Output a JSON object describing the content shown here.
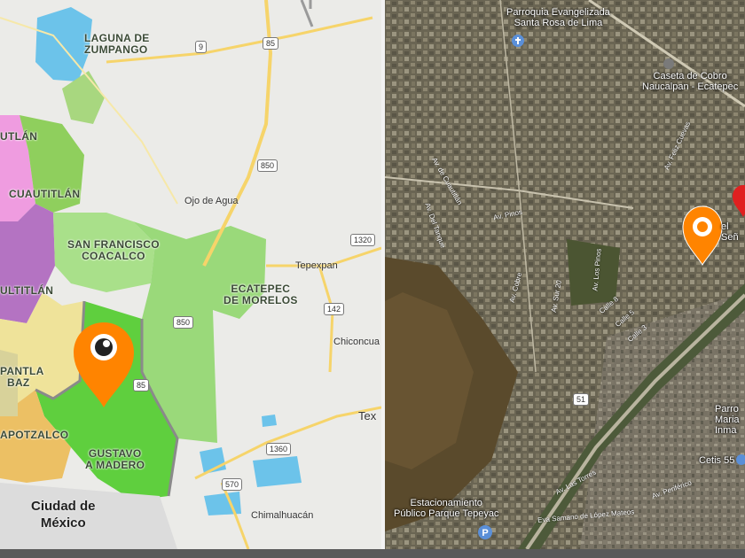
{
  "left_map": {
    "water": {
      "name": "LAGUNA DE ZUMPANGO",
      "line1": "LAGUNA DE",
      "line2": "ZUMPANGO"
    },
    "regions": {
      "cuautitlan_top": "UTLÁN",
      "cuautitlan": "CUAUTITLÁN",
      "san_francisco_line1": "SAN FRANCISCO",
      "san_francisco_line2": "COACALCO",
      "tultitlan": "ULTITLÁN",
      "ecatepec_line1": "ECATEPEC",
      "ecatepec_line2": "DE MORELOS",
      "tlalnepantla_line1": "PANTLA",
      "tlalnepantla_line2": "BAZ",
      "azcapotzalco": "APOTZALCO",
      "gustavo_line1": "GUSTAVO",
      "gustavo_line2": "A MADERO"
    },
    "places": {
      "ojo_de_agua": "Ojo de Agua",
      "tepexpan": "Tepexpan",
      "chiconcuac": "Chiconcua",
      "texcoco": "Tex",
      "chimalhuacan": "Chimalhuacán",
      "ciudad_line1": "Ciudad de",
      "ciudad_line2": "México"
    },
    "shields": {
      "r9": "9",
      "r85": "85",
      "r850": "850",
      "r1320": "1320",
      "r142": "142",
      "r1360": "1360",
      "r570": "570",
      "r850b": "850",
      "r85b": "85"
    },
    "marker_icon": "location-pin-icon",
    "colors": {
      "marker": "#ff8400",
      "water": "#6cc3ea"
    }
  },
  "right_map": {
    "labels": {
      "parroquia_line1": "Parroquia Evangelizada",
      "parroquia_line2": "Santa Rosa de Lima",
      "caseta_line1": "Caseta de Cobro",
      "caseta_line2": "Naucalpan - Ecatepec",
      "estacionamiento_line1": "Estacionamiento",
      "estacionamiento_line2": "Público Parque Tepeyac",
      "parroquia2_line1": "Parro",
      "parroquia2_line2": "Maria Inma",
      "cetis": "Cetis 55",
      "senor": "el Señ",
      "r51": "51"
    },
    "streets": [
      "Av. Pinos",
      "Av. Del Tanque",
      "Av. de Cuautitlán",
      "Av. Cobre",
      "Av. Sur 20",
      "Av. Feliz Cuevas",
      "Av. Las Torres",
      "Av. Periférico",
      "Eva Samano de López Mateos",
      "Calle 8",
      "Calle 5",
      "Calle 3",
      "Av. Los Pinos"
    ],
    "marker_icon": "location-pin-icon",
    "poi_icon": "place-icon",
    "parking_icon": "parking-icon",
    "colors": {
      "marker": "#ff8400",
      "poi": "#5a8fd8",
      "red_pin": "#e02020"
    }
  }
}
